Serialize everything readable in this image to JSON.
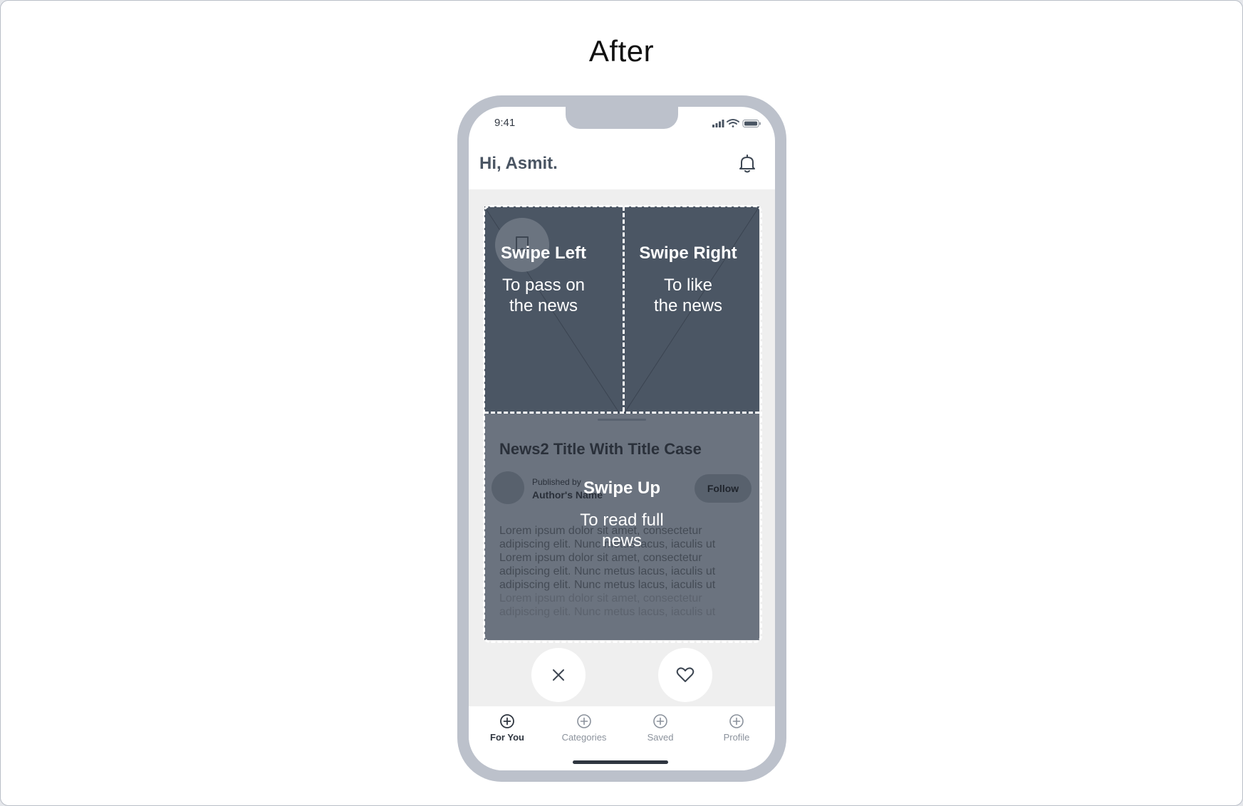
{
  "page": {
    "title": "After"
  },
  "status_bar": {
    "time": "9:41"
  },
  "header": {
    "greeting": "Hi, Asmit."
  },
  "card": {
    "swipe_left": {
      "title": "Swipe Left",
      "line1": "To pass on",
      "line2": "the news"
    },
    "swipe_right": {
      "title": "Swipe Right",
      "line1": "To like",
      "line2": "the news"
    },
    "swipe_up": {
      "title": "Swipe Up",
      "line1": "To read full",
      "line2": "news"
    },
    "news_title": "News2 Title With Title Case",
    "published_by": "Published by",
    "author_name": "Author's Name",
    "follow_label": "Follow",
    "body_lines": [
      "Lorem ipsum dolor sit amet, consectetur",
      "adipiscing elit. Nunc metus lacus, iaculis ut",
      "Lorem ipsum dolor sit amet, consectetur",
      "adipiscing elit. Nunc metus lacus, iaculis ut",
      "adipiscing elit. Nunc metus lacus, iaculis ut",
      "Lorem ipsum dolor sit amet, consectetur",
      "adipiscing elit. Nunc metus lacus, iaculis ut"
    ]
  },
  "actions": {
    "dismiss_icon": "close-icon",
    "like_icon": "heart-icon"
  },
  "tabs": [
    {
      "label": "For You",
      "icon": "plus-circle-icon",
      "active": true
    },
    {
      "label": "Categories",
      "icon": "plus-circle-icon",
      "active": false
    },
    {
      "label": "Saved",
      "icon": "plus-circle-icon",
      "active": false
    },
    {
      "label": "Profile",
      "icon": "plus-circle-icon",
      "active": false
    }
  ],
  "colors": {
    "phone_frame": "#bcc1cb",
    "card_top": "#4b5664",
    "card_bottom": "#6b737f",
    "content_bg": "#efefef"
  }
}
